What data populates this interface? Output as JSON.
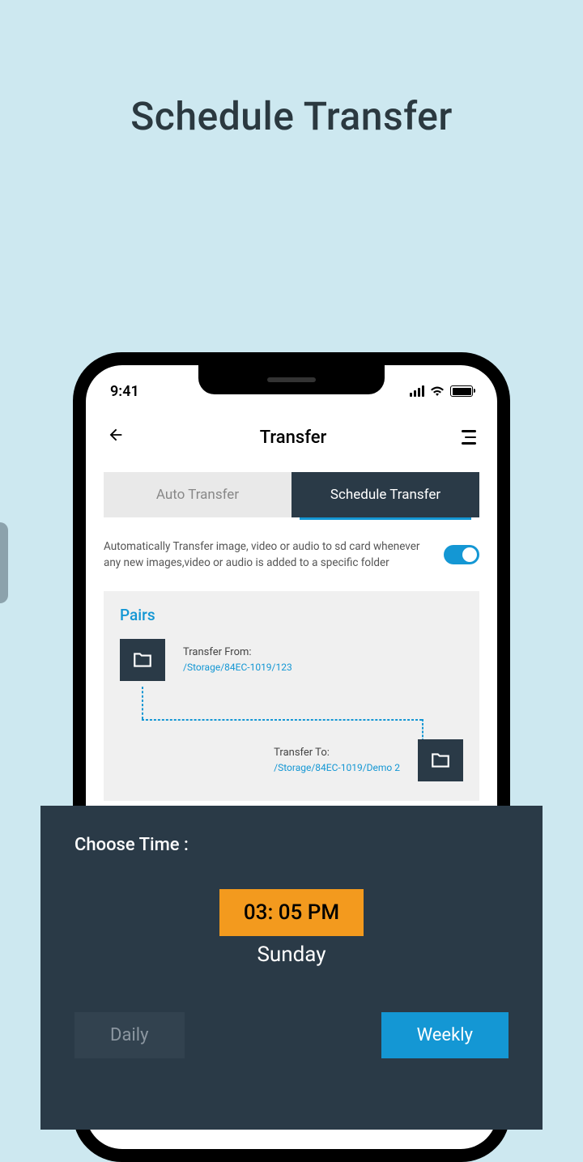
{
  "pageTitle": "Schedule Transfer",
  "statusBar": {
    "time": "9:41"
  },
  "header": {
    "title": "Transfer"
  },
  "tabs": {
    "auto": "Auto Transfer",
    "schedule": "Schedule Transfer"
  },
  "description": "Automatically Transfer image, video or audio to sd card whenever any new images,video or audio is added to a specific folder",
  "pairs": {
    "title": "Pairs",
    "from": {
      "label": "Transfer From:",
      "path": "/Storage/84EC-1019/123"
    },
    "to": {
      "label": "Transfer To:",
      "path": "/Storage/84EC-1019/Demo 2"
    }
  },
  "timePicker": {
    "chooseLabel": "Choose Time :",
    "time": "03: 05 PM",
    "day": "Sunday",
    "daily": "Daily",
    "weekly": "Weekly"
  }
}
